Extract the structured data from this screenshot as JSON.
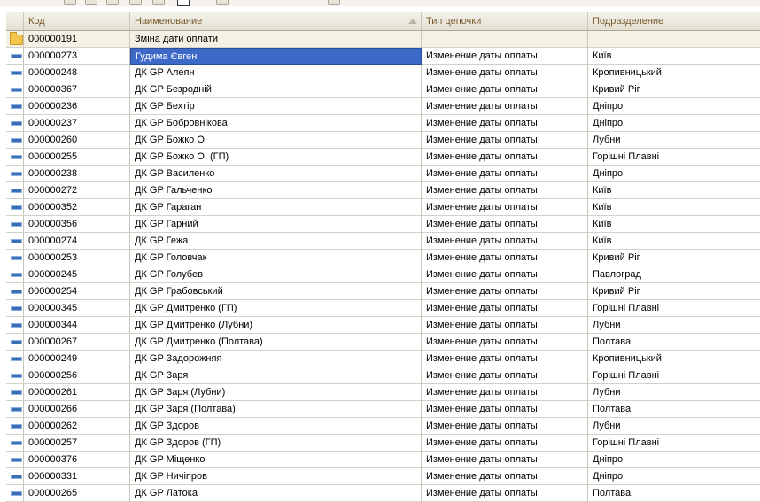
{
  "columns": {
    "code": "Код",
    "name": "Наименование",
    "chain_type": "Тип цепочки",
    "department": "Подразделение"
  },
  "group_row": {
    "code": "000000191",
    "name": "Зміна дати оплати",
    "chain_type": "",
    "department": ""
  },
  "rows": [
    {
      "code": "000000273",
      "name": "Гудима Євген",
      "chain_type": "Изменение даты оплаты",
      "department": "Київ",
      "selected": true
    },
    {
      "code": "000000248",
      "name": "ДК GP Алеян",
      "chain_type": "Изменение даты оплаты",
      "department": "Кропивницький"
    },
    {
      "code": "000000367",
      "name": "ДК GP Безродній",
      "chain_type": "Изменение даты оплаты",
      "department": "Кривий Ріг"
    },
    {
      "code": "000000236",
      "name": "ДК GP Бехтір",
      "chain_type": "Изменение даты оплаты",
      "department": "Дніпро"
    },
    {
      "code": "000000237",
      "name": "ДК GP Бобровнікова",
      "chain_type": "Изменение даты оплаты",
      "department": "Дніпро"
    },
    {
      "code": "000000260",
      "name": "ДК GP Божко О.",
      "chain_type": "Изменение даты оплаты",
      "department": "Лубни"
    },
    {
      "code": "000000255",
      "name": "ДК GP Божко О. (ГП)",
      "chain_type": "Изменение даты оплаты",
      "department": "Горішні Плавні"
    },
    {
      "code": "000000238",
      "name": "ДК GP Василенко",
      "chain_type": "Изменение даты оплаты",
      "department": "Дніпро"
    },
    {
      "code": "000000272",
      "name": "ДК GP Гальченко",
      "chain_type": "Изменение даты оплаты",
      "department": "Київ"
    },
    {
      "code": "000000352",
      "name": "ДК GP Гараган",
      "chain_type": "Изменение даты оплаты",
      "department": "Київ"
    },
    {
      "code": "000000356",
      "name": "ДК GP Гарний",
      "chain_type": "Изменение даты оплаты",
      "department": "Київ"
    },
    {
      "code": "000000274",
      "name": "ДК GP Гежа",
      "chain_type": "Изменение даты оплаты",
      "department": "Київ"
    },
    {
      "code": "000000253",
      "name": "ДК GP Головчак",
      "chain_type": "Изменение даты оплаты",
      "department": "Кривий Ріг"
    },
    {
      "code": "000000245",
      "name": "ДК GP Голубев",
      "chain_type": "Изменение даты оплаты",
      "department": "Павлоград"
    },
    {
      "code": "000000254",
      "name": "ДК GP Грабовський",
      "chain_type": "Изменение даты оплаты",
      "department": "Кривий Ріг"
    },
    {
      "code": "000000345",
      "name": "ДК GP Дмитренко (ГП)",
      "chain_type": "Изменение даты оплаты",
      "department": "Горішні Плавні"
    },
    {
      "code": "000000344",
      "name": "ДК GP Дмитренко (Лубни)",
      "chain_type": "Изменение даты оплаты",
      "department": "Лубни"
    },
    {
      "code": "000000267",
      "name": "ДК GP Дмитренко (Полтава)",
      "chain_type": "Изменение даты оплаты",
      "department": "Полтава"
    },
    {
      "code": "000000249",
      "name": "ДК GP Задорожняя",
      "chain_type": "Изменение даты оплаты",
      "department": "Кропивницький"
    },
    {
      "code": "000000256",
      "name": "ДК GP Заря",
      "chain_type": "Изменение даты оплаты",
      "department": "Горішні Плавні"
    },
    {
      "code": "000000261",
      "name": "ДК GP Заря (Лубни)",
      "chain_type": "Изменение даты оплаты",
      "department": "Лубни"
    },
    {
      "code": "000000266",
      "name": "ДК GP Заря (Полтава)",
      "chain_type": "Изменение даты оплаты",
      "department": "Полтава"
    },
    {
      "code": "000000262",
      "name": "ДК GP Здоров",
      "chain_type": "Изменение даты оплаты",
      "department": "Лубни"
    },
    {
      "code": "000000257",
      "name": "ДК GP Здоров (ГП)",
      "chain_type": "Изменение даты оплаты",
      "department": "Горішні Плавні"
    },
    {
      "code": "000000376",
      "name": "ДК GP Міщенко",
      "chain_type": "Изменение даты оплаты",
      "department": "Дніпро"
    },
    {
      "code": "000000331",
      "name": "ДК GP Ничіпров",
      "chain_type": "Изменение даты оплаты",
      "department": "Дніпро"
    },
    {
      "code": "000000265",
      "name": "ДК GP Латока",
      "chain_type": "Изменение даты оплаты",
      "department": "Полтава"
    }
  ],
  "icons": {
    "group": "folder-icon",
    "item": "list-item-icon",
    "sort": "sort-ascending-icon"
  }
}
